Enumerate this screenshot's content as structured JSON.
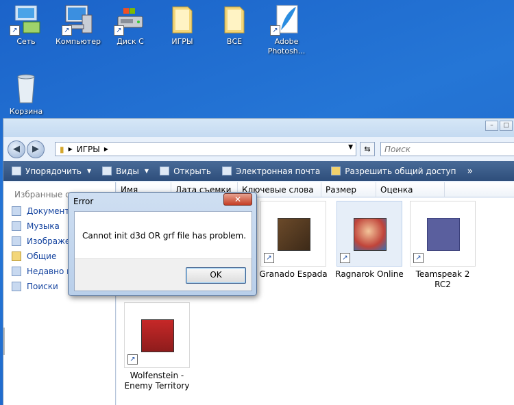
{
  "desktop": {
    "icons": [
      {
        "label": "Сеть"
      },
      {
        "label": "Компьютер"
      },
      {
        "label": "Диск С"
      },
      {
        "label": "ИГРЫ"
      },
      {
        "label": "ВСЕ"
      },
      {
        "label": "Adobe Photosh..."
      },
      {
        "label": "Корзина"
      }
    ]
  },
  "explorer": {
    "window_buttons": {
      "minimize": "–",
      "maximize": "□"
    },
    "address": {
      "path": "ИГРЫ"
    },
    "search": {
      "placeholder": "Поиск"
    },
    "toolbar": {
      "organize": "Упорядочить",
      "views": "Виды",
      "open": "Открыть",
      "email": "Электронная почта",
      "share": "Разрешить общий доступ",
      "more": "»"
    },
    "favorites": {
      "heading": "Избранные сс",
      "items": [
        {
          "label": "Документы"
        },
        {
          "label": "Музыка"
        },
        {
          "label": "Изображен"
        },
        {
          "label": "Общие"
        },
        {
          "label": "Недавно из"
        },
        {
          "label": "Поиски"
        }
      ]
    },
    "columns": [
      "Имя",
      "Дата съемки",
      "Ключевые слова",
      "Размер",
      "Оценка"
    ],
    "files": [
      {
        "label": "Granado Espada"
      },
      {
        "label": "Ragnarok Online"
      },
      {
        "label": "Teamspeak 2 RC2"
      },
      {
        "label": "Wolfenstein - Enemy Territory"
      }
    ]
  },
  "dialog": {
    "title": "Error",
    "close": "✕",
    "message": "Cannot init d3d OR grf file has problem.",
    "ok": "OK"
  },
  "colors": {
    "desktop_blue": "#2576d6",
    "toolbar": "#3a5b88",
    "link_blue": "#1645a0"
  }
}
